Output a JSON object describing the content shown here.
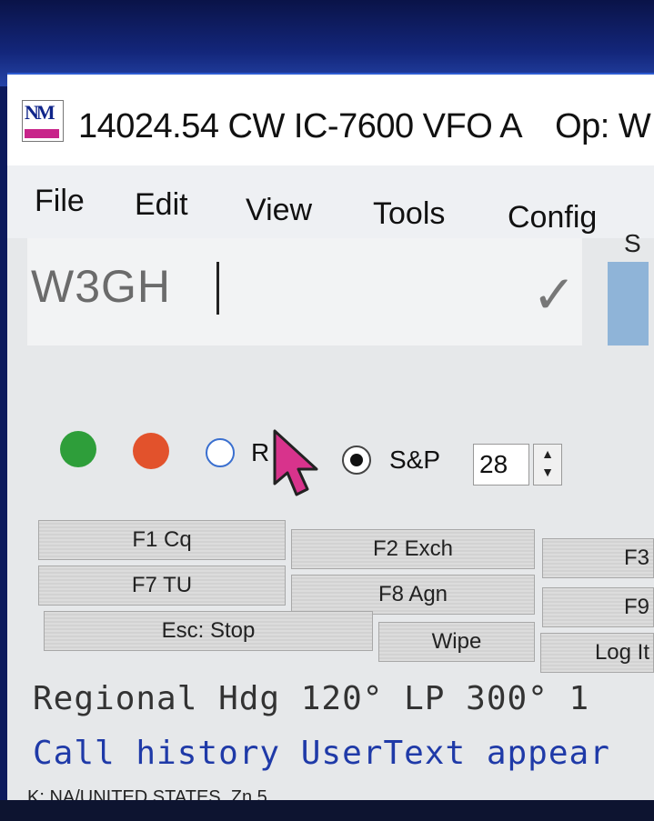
{
  "window": {
    "title": "14024.54 CW IC-7600 VFO A",
    "operator": "Op: W",
    "logo_text": "NM"
  },
  "menu": {
    "items": [
      "File",
      "Edit",
      "View",
      "Tools",
      "Config"
    ]
  },
  "entry": {
    "call_value": "W3GH",
    "check_icon": "checkmark-icon",
    "side_label": "S"
  },
  "mode": {
    "run_label": "R",
    "sp_label": "S&P",
    "sp_selected": true,
    "spin_value": "28"
  },
  "indicators": {
    "green": "#2e9e3a",
    "red": "#e2522c"
  },
  "function_keys": {
    "row1": [
      "F1 Cq",
      "F2 Exch",
      "F3"
    ],
    "row2": [
      "F7 TU",
      "F8 Agn",
      "F9"
    ],
    "row3": [
      "Esc: Stop",
      "Wipe",
      "Log It"
    ]
  },
  "info": {
    "regional": "Regional Hdg 120° LP 300° 1",
    "call_history": "Call history UserText appear",
    "status": "K: NA/UNITED STATES, Zn 5"
  },
  "colors": {
    "regional_text": "#333333",
    "history_text": "#1f3aa8"
  }
}
